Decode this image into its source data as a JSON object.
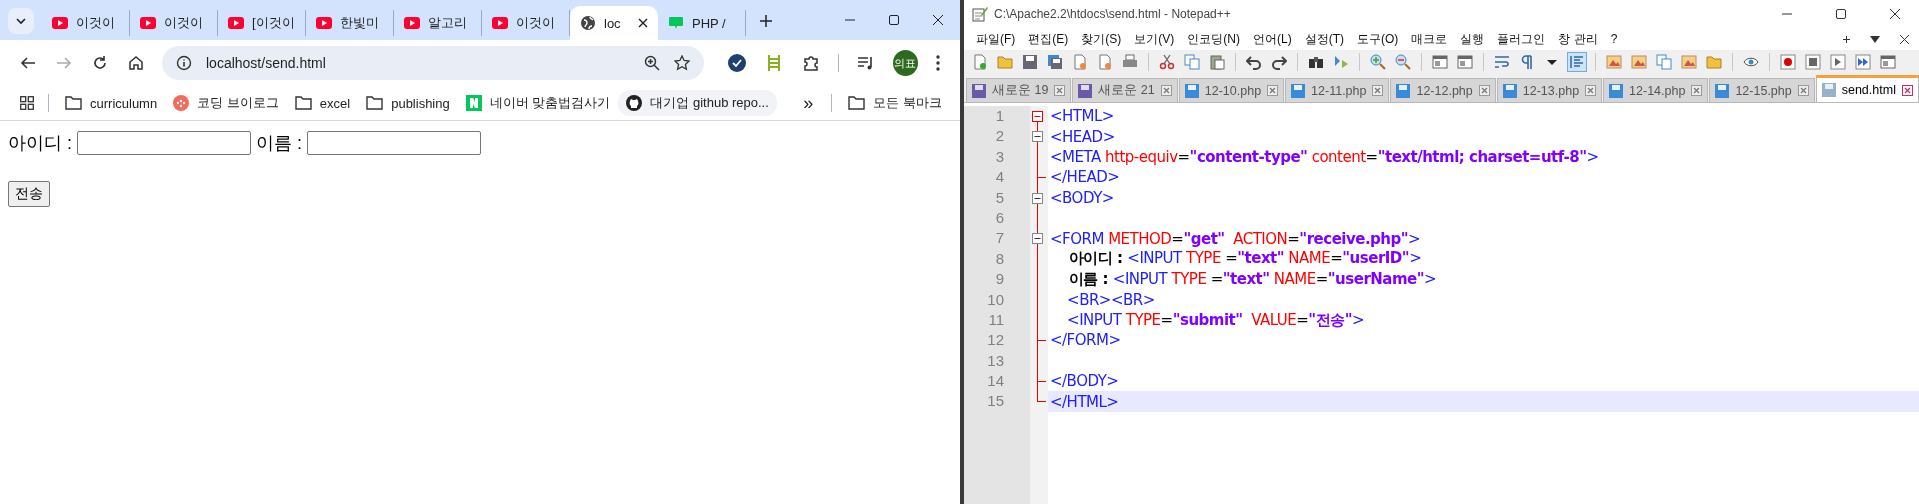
{
  "browser": {
    "tabs": [
      {
        "title": "이것이",
        "kind": "youtube",
        "selected": false
      },
      {
        "title": "이것이",
        "kind": "youtube",
        "selected": false
      },
      {
        "title": "[이것이",
        "kind": "youtube",
        "selected": false
      },
      {
        "title": "한빛미",
        "kind": "youtube",
        "selected": false
      },
      {
        "title": "알고리",
        "kind": "youtube",
        "selected": false
      },
      {
        "title": "이것이",
        "kind": "youtube",
        "selected": false
      },
      {
        "title": "loc",
        "kind": "globe",
        "selected": true
      },
      {
        "title": "PHP /",
        "kind": "blog",
        "selected": false
      }
    ],
    "address": "localhost/send.html",
    "profile": "의표",
    "bookmarks": [
      {
        "label": "curriculumn",
        "kind": "folder"
      },
      {
        "label": "코딩 브이로그",
        "kind": "dot"
      },
      {
        "label": "excel",
        "kind": "folder"
      },
      {
        "label": "publishing",
        "kind": "folder"
      },
      {
        "label": "네이버 맞춤법검사기",
        "kind": "naver"
      },
      {
        "label": "대기업 github repo...",
        "kind": "github"
      }
    ],
    "overflow": "»",
    "all_bookmarks": "모든 북마크",
    "page": {
      "fields": [
        {
          "label": "아이디 :"
        },
        {
          "label": "이름 :"
        }
      ],
      "submit": "전송"
    }
  },
  "editor": {
    "title": "C:\\Apache2.2\\htdocs\\send.html - Notepad++",
    "menu": [
      "파일(F)",
      "편집(E)",
      "찾기(S)",
      "보기(V)",
      "인코딩(N)",
      "언어(L)",
      "설정(T)",
      "도구(O)",
      "매크로",
      "실행",
      "플러그인",
      "창 관리",
      "?"
    ],
    "tabs": [
      {
        "label": "새로운 19",
        "kind": "new",
        "selected": false
      },
      {
        "label": "새로운 21",
        "kind": "new",
        "selected": false
      },
      {
        "label": "12-10.php",
        "kind": "file",
        "selected": false
      },
      {
        "label": "12-11.php",
        "kind": "file",
        "selected": false
      },
      {
        "label": "12-12.php",
        "kind": "file",
        "selected": false
      },
      {
        "label": "12-13.php",
        "kind": "file",
        "selected": false
      },
      {
        "label": "12-14.php",
        "kind": "file",
        "selected": false
      },
      {
        "label": "12-15.php",
        "kind": "file",
        "selected": false
      },
      {
        "label": "send.html",
        "kind": "file",
        "selected": true
      }
    ],
    "lines": [
      {
        "number": "1",
        "kind": "open-active",
        "current": false,
        "tokens": [
          {
            "kind": "tag",
            "text": "<HTML>"
          }
        ]
      },
      {
        "number": "2",
        "kind": "open",
        "current": false,
        "tokens": [
          {
            "kind": "tag",
            "text": "<HEAD>"
          }
        ]
      },
      {
        "number": "3",
        "kind": "line",
        "current": false,
        "tokens": [
          {
            "kind": "tag",
            "text": "<META "
          },
          {
            "kind": "attr",
            "text": "http-equiv"
          },
          {
            "kind": "op",
            "text": "="
          },
          {
            "kind": "value",
            "text": "\"content-type\""
          },
          {
            "kind": "attr",
            "text": " content"
          },
          {
            "kind": "op",
            "text": "="
          },
          {
            "kind": "value",
            "text": "\"text/html; charset=utf-8\""
          },
          {
            "kind": "tag",
            "text": ">"
          }
        ]
      },
      {
        "number": "4",
        "kind": "end",
        "current": false,
        "tokens": [
          {
            "kind": "tag",
            "text": "</HEAD>"
          }
        ]
      },
      {
        "number": "5",
        "kind": "open",
        "current": false,
        "tokens": [
          {
            "kind": "tag",
            "text": "<BODY>"
          }
        ]
      },
      {
        "number": "6",
        "kind": "line",
        "current": false
      },
      {
        "number": "7",
        "kind": "open",
        "current": false,
        "tokens": [
          {
            "kind": "tag",
            "text": "<FORM "
          },
          {
            "kind": "attr",
            "text": "METHOD"
          },
          {
            "kind": "op",
            "text": "="
          },
          {
            "kind": "value",
            "text": "\"get\""
          },
          {
            "kind": "attr",
            "text": "  ACTION"
          },
          {
            "kind": "op",
            "text": "="
          },
          {
            "kind": "value",
            "text": "\"receive.php\""
          },
          {
            "kind": "tag",
            "text": ">"
          }
        ]
      },
      {
        "number": "8",
        "kind": "line",
        "current": false,
        "tokens": [
          {
            "kind": "text",
            "text": "    아이디 : "
          },
          {
            "kind": "tag",
            "text": "<INPUT "
          },
          {
            "kind": "attr",
            "text": "TYPE "
          },
          {
            "kind": "op",
            "text": "="
          },
          {
            "kind": "value",
            "text": "\"text\""
          },
          {
            "kind": "attr",
            "text": " NAME"
          },
          {
            "kind": "op",
            "text": "="
          },
          {
            "kind": "value",
            "text": "\"userID\""
          },
          {
            "kind": "tag",
            "text": ">"
          }
        ]
      },
      {
        "number": "9",
        "kind": "line",
        "current": false,
        "tokens": [
          {
            "kind": "text",
            "text": "    이름 : "
          },
          {
            "kind": "tag",
            "text": "<INPUT "
          },
          {
            "kind": "attr",
            "text": "TYPE "
          },
          {
            "kind": "op",
            "text": "="
          },
          {
            "kind": "value",
            "text": "\"text\""
          },
          {
            "kind": "attr",
            "text": " NAME"
          },
          {
            "kind": "op",
            "text": "="
          },
          {
            "kind": "value",
            "text": "\"userName\""
          },
          {
            "kind": "tag",
            "text": ">"
          }
        ]
      },
      {
        "number": "10",
        "kind": "line",
        "current": false,
        "tokens": [
          {
            "kind": "tag",
            "text": "    <BR><BR>"
          }
        ]
      },
      {
        "number": "11",
        "kind": "line",
        "current": false,
        "tokens": [
          {
            "kind": "tag",
            "text": "    <INPUT "
          },
          {
            "kind": "attr",
            "text": "TYPE"
          },
          {
            "kind": "op",
            "text": "="
          },
          {
            "kind": "value",
            "text": "\"submit\""
          },
          {
            "kind": "attr",
            "text": "  VALUE"
          },
          {
            "kind": "op",
            "text": "="
          },
          {
            "kind": "value",
            "text": "\"전송\""
          },
          {
            "kind": "tag",
            "text": ">"
          }
        ]
      },
      {
        "number": "12",
        "kind": "end",
        "current": false,
        "tokens": [
          {
            "kind": "tag",
            "text": "</FORM>"
          }
        ]
      },
      {
        "number": "13",
        "kind": "line",
        "current": false
      },
      {
        "number": "14",
        "kind": "end",
        "current": false,
        "tokens": [
          {
            "kind": "tag",
            "text": "</BODY>"
          }
        ]
      },
      {
        "number": "15",
        "kind": "last",
        "current": true,
        "tokens": [
          {
            "kind": "tag",
            "text": "</HTML>"
          }
        ]
      }
    ]
  }
}
